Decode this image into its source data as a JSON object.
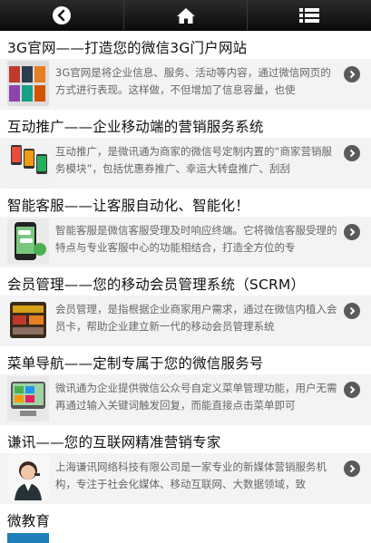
{
  "nav": {
    "back_icon": "back-circle-icon",
    "home_icon": "home-icon",
    "menu_icon": "list-menu-icon"
  },
  "items": [
    {
      "title": "3G官网——打造您的微信3G门户网站",
      "desc": "3G官网是将企业信息、服务、活动等内容，通过微信网页的方式进行表现。这样做，不但增加了信息容量，也使",
      "thumb": "website-thumb"
    },
    {
      "title": "互动推广——企业移动端的营销服务系统",
      "desc": "互动推广，是微讯通为商家的微信号定制内置的“商家营销服务模块”，包括优惠券推广、幸运大转盘推广、刮刮",
      "thumb": "promotion-thumb"
    },
    {
      "title": "智能客服——让客服自动化、智能化！",
      "desc": "智能客服是微信客服受理及时响应终端。它将微信客服受理的特点与专业客服中心的功能相结合，打造全方位的专",
      "thumb": "service-thumb"
    },
    {
      "title": "会员管理——您的移动会员管理系统（SCRM）",
      "desc": "会员管理，是指根据企业商家用户需求，通过在微信内植入会员卡，帮助企业建立新一代的移动会员管理系统",
      "thumb": "member-thumb"
    },
    {
      "title": "菜单导航——定制专属于您的微信服务号",
      "desc": "微讯通为企业提供微信公众号自定义菜单管理功能，用户无需再通过输入关键词触发回复，而能直接点击菜单即可",
      "thumb": "menu-thumb"
    },
    {
      "title": "谦讯——您的互联网精准营销专家",
      "desc": "上海谦讯网络科技有限公司是一家专业的新媒体营销服务机构，专注于社会化媒体、移动互联网、大数据领域，致",
      "thumb": "company-thumb"
    }
  ],
  "last_item": {
    "title": "微教育"
  }
}
